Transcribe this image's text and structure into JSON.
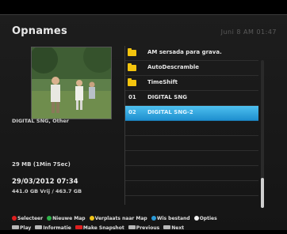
{
  "header": {
    "title": "Opnames",
    "clock": "Juni 8 AM 01:47"
  },
  "details": {
    "channel": "DIGITAL SNG, Other",
    "size": "29 MB (1Min 7Sec)",
    "date": "29/03/2012 07:34",
    "disk": "441.0 GB Vrij / 463.7 GB"
  },
  "list": {
    "items": [
      {
        "type": "folder",
        "num": "",
        "label": "AM sersada para grava.",
        "icon": "folder-icon"
      },
      {
        "type": "folder",
        "num": "",
        "label": "AutoDescramble",
        "icon": "folder-icon"
      },
      {
        "type": "folder",
        "num": "",
        "label": "TimeShift",
        "icon": "folder-icon"
      },
      {
        "type": "file",
        "num": "01",
        "label": "DIGITAL SNG"
      },
      {
        "type": "file",
        "num": "02",
        "label": "DIGITAL SNG-2",
        "selected": true
      }
    ]
  },
  "legend": {
    "row1": [
      {
        "color": "#e02020",
        "label": "Selecteer",
        "icon": "red-button-icon"
      },
      {
        "color": "#2fb34a",
        "label": "Nieuwe Map",
        "icon": "green-button-icon"
      },
      {
        "color": "#f0c419",
        "label": "Verplaats naar Map",
        "icon": "yellow-button-icon"
      },
      {
        "color": "#2a9ad8",
        "label": "Wis bestand",
        "icon": "blue-button-icon"
      },
      {
        "color": "#f2f2f2",
        "label": "Opties",
        "icon": "white-button-icon"
      }
    ],
    "row2": [
      {
        "label": "Play",
        "icon": "ok-button-icon"
      },
      {
        "label": "Informatie",
        "icon": "info-button-icon"
      },
      {
        "label": "Make Snapshot",
        "icon": "record-button-icon",
        "color": "#e02020"
      },
      {
        "label": "Previous",
        "icon": "rewind-button-icon"
      },
      {
        "label": "Next",
        "icon": "forward-button-icon"
      }
    ]
  }
}
